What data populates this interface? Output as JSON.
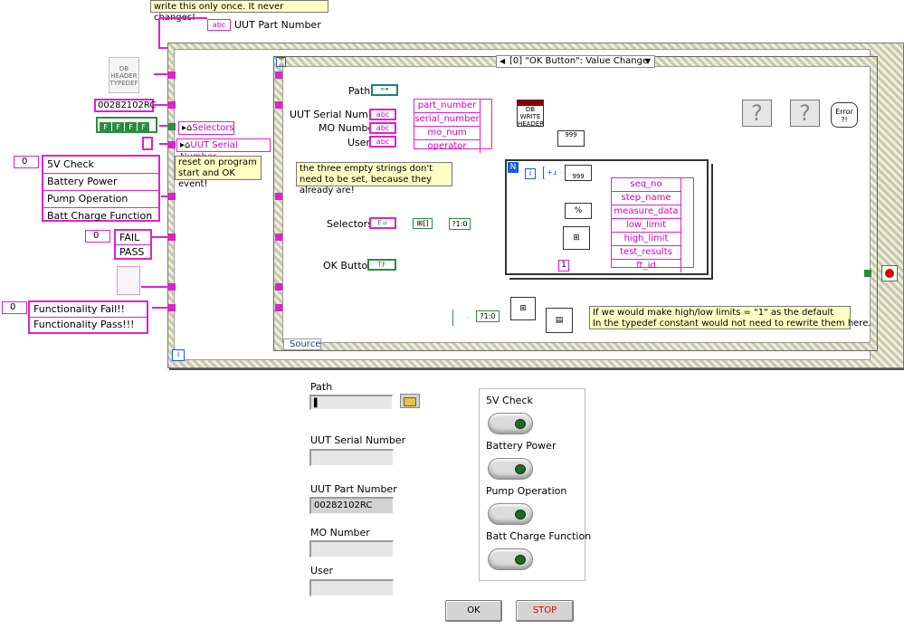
{
  "diagram": {
    "top_note": "write this only once. It never changes!",
    "uut_part_number_label": "UUT Part Number",
    "uut_part_number_tag": "abc",
    "db_header_icon": "DB HEADER TYPEDEF",
    "part_number_constant": "00282102RC",
    "bool_array": [
      "F",
      "F",
      "F",
      "F"
    ],
    "selectors_local": "Selectors",
    "uut_serial_local": "UUT Serial Number",
    "reset_note": "reset on program start and OK event!",
    "ring_list_1": {
      "index": "0",
      "items": [
        "5V Check",
        "Battery Power",
        "Pump Operation",
        "Batt Charge Function"
      ]
    },
    "ring_list_2": {
      "index": "0",
      "items": [
        "FAIL",
        "PASS"
      ]
    },
    "ring_list_3": {
      "index": "0",
      "items": [
        "Functionality Fail!!",
        "Functionality Pass!!!"
      ]
    },
    "event_case": "[0] \"OK Button\": Value Change",
    "terminals": {
      "path": "Path",
      "uut_serial": "UUT Serial Number",
      "mo_number": "MO Number",
      "user": "User",
      "selectors": "Selectors",
      "ok_button": "OK Button"
    },
    "terminal_tags": {
      "path": "⊶",
      "abc": "abc",
      "sel": "F=",
      "tf": "TF"
    },
    "bundle_1": [
      "part_number",
      "serial_number",
      "mo_num",
      "operator"
    ],
    "bundle_2": [
      "seq_no",
      "step_name",
      "measure_data",
      "low_limit",
      "high_limit",
      "test_results",
      "ft_id"
    ],
    "note_empty_strings": "the three empty strings don't need to be set, because they already are!",
    "note_limits": "If we would make high/low limits = \"1\" as the default\nIn the typedef constant would not need to rewrite them here.",
    "db_write_header": "DB WRITE HEADER",
    "loop_n": "N",
    "loop_i": "i",
    "constant_one": "1",
    "selector_format": "?1:0",
    "increment": "+1",
    "number_999": "999",
    "format_pct": "%",
    "source_label": "Source",
    "error_icon": "Error ?!",
    "question_mark": "?",
    "while_i": "i",
    "colors": {
      "pink": "#e020d0",
      "blue": "#1a5ae0",
      "green": "#2c8c40",
      "teal": "#188080"
    }
  },
  "front_panel": {
    "path": {
      "label": "Path",
      "value": ""
    },
    "uut_serial": {
      "label": "UUT Serial Number",
      "value": ""
    },
    "uut_part": {
      "label": "UUT Part Number",
      "value": "00282102RC"
    },
    "mo_number": {
      "label": "MO Number",
      "value": ""
    },
    "user": {
      "label": "User",
      "value": ""
    },
    "checks": [
      "5V Check",
      "Battery Power",
      "Pump Operation",
      "Batt Charge Function"
    ],
    "ok_label": "OK",
    "stop_label": "STOP"
  }
}
